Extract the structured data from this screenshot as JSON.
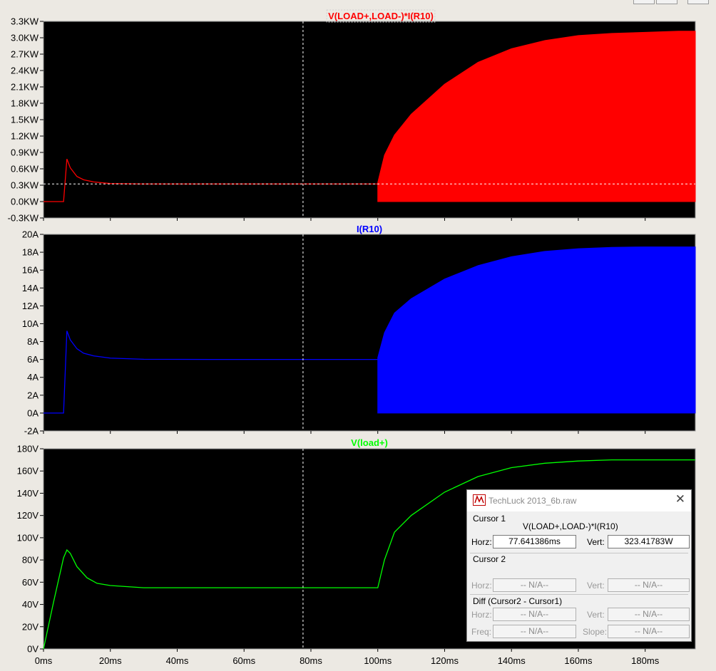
{
  "window": {
    "background": "#ece9e3"
  },
  "chart_data": [
    {
      "type": "line",
      "title": "V(LOAD+,LOAD-)*I(R10)",
      "color": "#ff0000",
      "xlim": [
        0,
        195
      ],
      "ylim": [
        -0.3,
        3.3
      ],
      "yticks": [
        "3.3KW",
        "3.0KW",
        "2.7KW",
        "2.4KW",
        "2.1KW",
        "1.8KW",
        "1.5KW",
        "1.2KW",
        "0.9KW",
        "0.6KW",
        "0.3KW",
        "0.0KW",
        "-0.3KW"
      ],
      "ytick_values": [
        3.3,
        3.0,
        2.7,
        2.4,
        2.1,
        1.8,
        1.5,
        1.2,
        0.9,
        0.6,
        0.3,
        0.0,
        -0.3
      ],
      "series": [
        {
          "x": [
            0,
            6,
            7,
            8,
            10,
            12,
            15,
            20,
            30,
            50,
            100
          ],
          "y": [
            0,
            0,
            0.78,
            0.62,
            0.46,
            0.4,
            0.36,
            0.33,
            0.323,
            0.323,
            0.323
          ]
        }
      ],
      "envelope": {
        "x": [
          100,
          102,
          105,
          110,
          120,
          130,
          140,
          150,
          160,
          170,
          180,
          190,
          195
        ],
        "upper": [
          0.35,
          0.85,
          1.22,
          1.6,
          2.15,
          2.55,
          2.8,
          2.95,
          3.04,
          3.08,
          3.1,
          3.12,
          3.12
        ],
        "lower": 0.0
      }
    },
    {
      "type": "line",
      "title": "I(R10)",
      "color": "#0000ff",
      "xlim": [
        0,
        195
      ],
      "ylim": [
        -2,
        20
      ],
      "yticks": [
        "20A",
        "18A",
        "16A",
        "14A",
        "12A",
        "10A",
        "8A",
        "6A",
        "4A",
        "2A",
        "0A",
        "-2A"
      ],
      "ytick_values": [
        20,
        18,
        16,
        14,
        12,
        10,
        8,
        6,
        4,
        2,
        0,
        -2
      ],
      "series": [
        {
          "x": [
            0,
            6,
            7,
            8,
            10,
            12,
            15,
            20,
            30,
            50,
            100
          ],
          "y": [
            0,
            0,
            9.2,
            8.2,
            7.2,
            6.7,
            6.4,
            6.15,
            6.02,
            6.0,
            6.0
          ]
        }
      ],
      "envelope": {
        "x": [
          100,
          102,
          105,
          110,
          120,
          130,
          140,
          150,
          160,
          170,
          180,
          195
        ],
        "upper": [
          6.2,
          9.0,
          11.2,
          12.8,
          15.0,
          16.5,
          17.5,
          18.1,
          18.4,
          18.55,
          18.6,
          18.6
        ],
        "lower": 0.0
      }
    },
    {
      "type": "line",
      "title": "V(load+)",
      "color": "#00ff00",
      "xlim": [
        0,
        195
      ],
      "ylim": [
        0,
        180
      ],
      "yticks": [
        "180V",
        "160V",
        "140V",
        "120V",
        "100V",
        "80V",
        "60V",
        "40V",
        "20V",
        "0V"
      ],
      "ytick_values": [
        180,
        160,
        140,
        120,
        100,
        80,
        60,
        40,
        20,
        0
      ],
      "xticks": [
        "0ms",
        "20ms",
        "40ms",
        "60ms",
        "80ms",
        "100ms",
        "120ms",
        "140ms",
        "160ms",
        "180ms"
      ],
      "xtick_values": [
        0,
        20,
        40,
        60,
        80,
        100,
        120,
        140,
        160,
        180
      ],
      "series": [
        {
          "x": [
            0,
            3,
            6,
            7,
            8,
            10,
            13,
            16,
            20,
            30,
            50,
            100,
            102,
            105,
            110,
            120,
            130,
            140,
            150,
            160,
            170,
            180,
            195
          ],
          "y": [
            0,
            42,
            82,
            89,
            86,
            74,
            64,
            59,
            57,
            55,
            55,
            55,
            80,
            105,
            120,
            141,
            155,
            163,
            167,
            169,
            170,
            170,
            170
          ]
        }
      ]
    }
  ],
  "cursor": {
    "x": 77.641386,
    "y": 0.32341783
  },
  "dialog": {
    "title": "TechLuck 2013_6b.raw",
    "cursor1_label": "Cursor 1",
    "trace_name": "V(LOAD+,LOAD-)*I(R10)",
    "horz_label": "Horz:",
    "vert_label": "Vert:",
    "cursor1_horz": "77.641386ms",
    "cursor1_vert": "323.41783W",
    "cursor2_label": "Cursor 2",
    "cursor2_horz": "-- N/A--",
    "cursor2_vert": "-- N/A--",
    "diff_label": "Diff (Cursor2 - Cursor1)",
    "freq_label": "Freq:",
    "slope_label": "Slope:",
    "diff_horz": "-- N/A--",
    "diff_vert": "-- N/A--",
    "diff_freq": "-- N/A--",
    "diff_slope": "-- N/A--"
  }
}
